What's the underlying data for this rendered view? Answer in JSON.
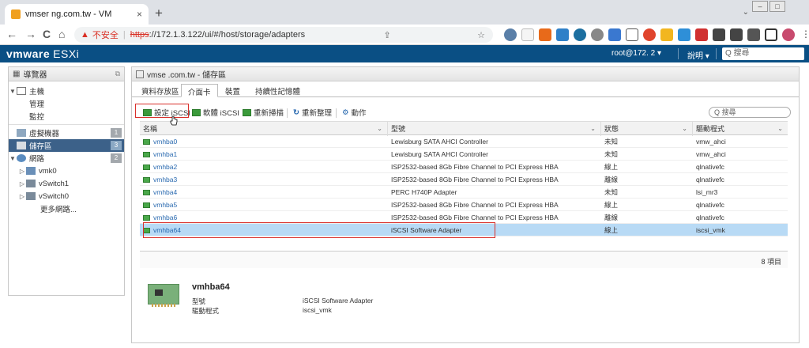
{
  "browser": {
    "tab_title": "vmser        ng.com.tw - VM",
    "tab_close": "×",
    "new_tab": "+",
    "nav_back": "←",
    "nav_forward": "→",
    "nav_reload": "C",
    "nav_home": "⌂",
    "insecure_label": "不安全",
    "url_scheme": "https",
    "url_rest": "://172.1.3.122/ui/#/host/storage/adapters"
  },
  "esxi": {
    "logo": "vmware",
    "product": "ESXi",
    "user": "root@172.      2 ▾",
    "help": "說明 ▾",
    "search_placeholder": "Q 搜尋"
  },
  "navigator": {
    "title": "導覽器",
    "items": [
      {
        "label": "主機",
        "type": "host"
      },
      {
        "label": "管理",
        "type": "child"
      },
      {
        "label": "監控",
        "type": "child"
      },
      {
        "label": "虛擬機器",
        "count": "1"
      },
      {
        "label": "儲存區",
        "count": "3",
        "selected": true
      },
      {
        "label": "網路",
        "count": "2"
      },
      {
        "label": "vmk0"
      },
      {
        "label": "vSwitch1"
      },
      {
        "label": "vSwitch0"
      },
      {
        "label": "更多網路..."
      }
    ]
  },
  "main": {
    "title": "vmse              .com.tw - 儲存區",
    "tabs": [
      "資料存放區",
      "介面卡",
      "裝置",
      "持續性記憶體"
    ],
    "active_tab": "介面卡",
    "toolbar": {
      "configure_iscsi": "設定 iSCSI",
      "software_iscsi": "軟體 iSCSI",
      "rescan": "重新掃描",
      "refresh": "重新整理",
      "actions": "動作"
    },
    "search_placeholder": "Q 搜尋",
    "columns": [
      "名稱",
      "型號",
      "狀態",
      "驅動程式"
    ],
    "rows": [
      {
        "name": "vmhba0",
        "model": "Lewisburg SATA AHCI Controller",
        "status": "未知",
        "driver": "vmw_ahci"
      },
      {
        "name": "vmhba1",
        "model": "Lewisburg SATA AHCI Controller",
        "status": "未知",
        "driver": "vmw_ahci"
      },
      {
        "name": "vmhba2",
        "model": "ISP2532-based 8Gb Fibre Channel to PCI Express HBA",
        "status": "線上",
        "driver": "qlnativefc"
      },
      {
        "name": "vmhba3",
        "model": "ISP2532-based 8Gb Fibre Channel to PCI Express HBA",
        "status": "離線",
        "driver": "qlnativefc"
      },
      {
        "name": "vmhba4",
        "model": "PERC H740P Adapter",
        "status": "未知",
        "driver": "lsi_mr3"
      },
      {
        "name": "vmhba5",
        "model": "ISP2532-based 8Gb Fibre Channel to PCI Express HBA",
        "status": "線上",
        "driver": "qlnativefc"
      },
      {
        "name": "vmhba6",
        "model": "ISP2532-based 8Gb Fibre Channel to PCI Express HBA",
        "status": "離線",
        "driver": "qlnativefc"
      },
      {
        "name": "vmhba64",
        "model": "iSCSI Software Adapter",
        "status": "線上",
        "driver": "iscsi_vmk"
      }
    ],
    "item_count": "8 項目",
    "detail": {
      "title": "vmhba64",
      "model_label": "型號",
      "model_value": "iSCSI Software Adapter",
      "driver_label": "驅動程式",
      "driver_value": "iscsi_vmk"
    }
  },
  "colors": {
    "esxi_header": "#0a4f84",
    "selected_nav": "#3c6189",
    "selected_row": "#b8daf5",
    "highlight_box": "#d9302b"
  }
}
